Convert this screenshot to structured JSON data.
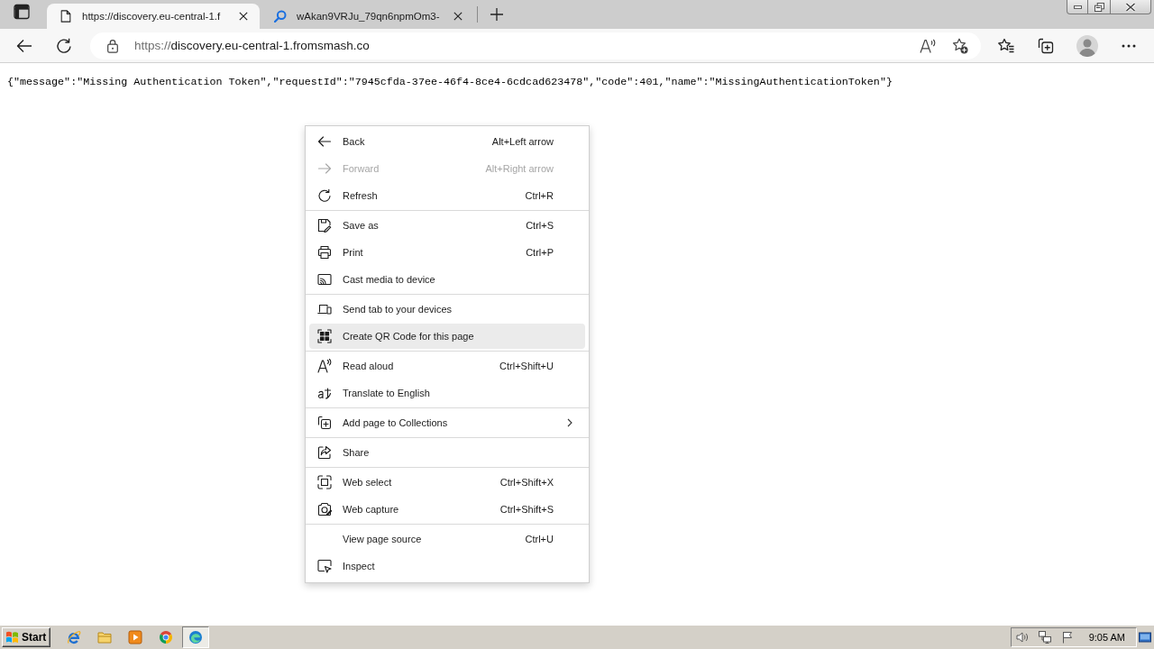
{
  "tabs": [
    {
      "title": "https://discovery.eu-central-1.f",
      "selected": true
    },
    {
      "title": "wAkan9VRJu_79qn6npmOm3-",
      "selected": false
    }
  ],
  "address_bar": {
    "scheme": "https://",
    "host": "discovery.eu-central-1.fromsmash.co"
  },
  "page": {
    "text": "{\"message\":\"Missing Authentication Token\",\"requestId\":\"7945cfda-37ee-46f4-8ce4-6cdcad623478\",\"code\":401,\"name\":\"MissingAuthenticationToken\"}"
  },
  "context_menu": {
    "sections": [
      {
        "items": [
          {
            "label": "Back",
            "shortcut": "Alt+Left arrow",
            "disabled": false,
            "highlighted": false,
            "submenu": false
          },
          {
            "label": "Forward",
            "shortcut": "Alt+Right arrow",
            "disabled": true,
            "highlighted": false,
            "submenu": false
          },
          {
            "label": "Refresh",
            "shortcut": "Ctrl+R",
            "disabled": false,
            "highlighted": false,
            "submenu": false
          }
        ]
      },
      {
        "items": [
          {
            "label": "Save as",
            "shortcut": "Ctrl+S",
            "disabled": false,
            "highlighted": false,
            "submenu": false
          },
          {
            "label": "Print",
            "shortcut": "Ctrl+P",
            "disabled": false,
            "highlighted": false,
            "submenu": false
          },
          {
            "label": "Cast media to device",
            "disabled": false,
            "highlighted": false,
            "submenu": false
          }
        ]
      },
      {
        "items": [
          {
            "label": "Send tab to your devices",
            "disabled": false,
            "highlighted": false,
            "submenu": false
          },
          {
            "label": "Create QR Code for this page",
            "disabled": false,
            "highlighted": true,
            "submenu": false
          }
        ]
      },
      {
        "items": [
          {
            "label": "Read aloud",
            "shortcut": "Ctrl+Shift+U",
            "disabled": false,
            "highlighted": false,
            "submenu": false
          },
          {
            "label": "Translate to English",
            "disabled": false,
            "highlighted": false,
            "submenu": false
          }
        ]
      },
      {
        "items": [
          {
            "label": "Add page to Collections",
            "disabled": false,
            "highlighted": false,
            "submenu": true
          }
        ]
      },
      {
        "items": [
          {
            "label": "Share",
            "disabled": false,
            "highlighted": false,
            "submenu": false
          }
        ]
      },
      {
        "items": [
          {
            "label": "Web select",
            "shortcut": "Ctrl+Shift+X",
            "disabled": false,
            "highlighted": false,
            "submenu": false
          },
          {
            "label": "Web capture",
            "shortcut": "Ctrl+Shift+S",
            "disabled": false,
            "highlighted": false,
            "submenu": false
          }
        ]
      },
      {
        "items": [
          {
            "label": "View page source",
            "shortcut": "Ctrl+U",
            "disabled": false,
            "highlighted": false,
            "submenu": false
          },
          {
            "label": "Inspect",
            "disabled": false,
            "highlighted": false,
            "submenu": false
          }
        ]
      }
    ]
  },
  "taskbar": {
    "start": "Start",
    "apps": [
      {
        "selected": false
      },
      {
        "selected": false
      },
      {
        "selected": false
      },
      {
        "selected": false
      },
      {
        "selected": true
      }
    ],
    "clock": "9:05 AM"
  }
}
